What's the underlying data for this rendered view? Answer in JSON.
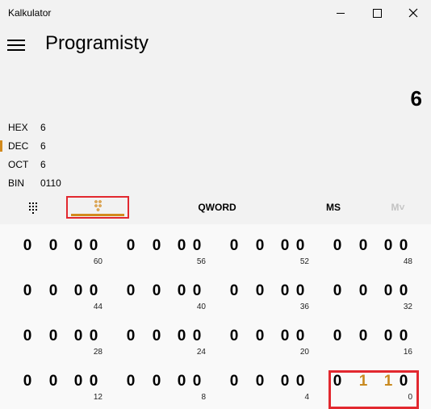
{
  "window": {
    "title": "Kalkulator"
  },
  "header": {
    "mode_title": "Programisty"
  },
  "display": {
    "value": "6",
    "radix": [
      {
        "name": "HEX",
        "value": "6",
        "selected": false
      },
      {
        "name": "DEC",
        "value": "6",
        "selected": true
      },
      {
        "name": "OCT",
        "value": "6",
        "selected": false
      },
      {
        "name": "BIN",
        "value": "0110",
        "selected": false
      }
    ]
  },
  "toolbar": {
    "keypad_icon": "keypad-dots-icon",
    "bitflip_icon": "bit-flip-icon",
    "word_size": "QWORD",
    "memory_store": "MS",
    "memory_view": "M˅"
  },
  "bit_groups": [
    {
      "bits": [
        "0",
        "0",
        "0",
        "0"
      ],
      "index": "60"
    },
    {
      "bits": [
        "0",
        "0",
        "0",
        "0"
      ],
      "index": "56"
    },
    {
      "bits": [
        "0",
        "0",
        "0",
        "0"
      ],
      "index": "52"
    },
    {
      "bits": [
        "0",
        "0",
        "0",
        "0"
      ],
      "index": "48"
    },
    {
      "bits": [
        "0",
        "0",
        "0",
        "0"
      ],
      "index": "44"
    },
    {
      "bits": [
        "0",
        "0",
        "0",
        "0"
      ],
      "index": "40"
    },
    {
      "bits": [
        "0",
        "0",
        "0",
        "0"
      ],
      "index": "36"
    },
    {
      "bits": [
        "0",
        "0",
        "0",
        "0"
      ],
      "index": "32"
    },
    {
      "bits": [
        "0",
        "0",
        "0",
        "0"
      ],
      "index": "28"
    },
    {
      "bits": [
        "0",
        "0",
        "0",
        "0"
      ],
      "index": "24"
    },
    {
      "bits": [
        "0",
        "0",
        "0",
        "0"
      ],
      "index": "20"
    },
    {
      "bits": [
        "0",
        "0",
        "0",
        "0"
      ],
      "index": "16"
    },
    {
      "bits": [
        "0",
        "0",
        "0",
        "0"
      ],
      "index": "12"
    },
    {
      "bits": [
        "0",
        "0",
        "0",
        "0"
      ],
      "index": "8"
    },
    {
      "bits": [
        "0",
        "0",
        "0",
        "0"
      ],
      "index": "4"
    },
    {
      "bits": [
        "0",
        "1",
        "1",
        "0"
      ],
      "index": "0"
    }
  ],
  "colors": {
    "accent": "#d28a1e",
    "highlight": "#e2282f",
    "bit_on": "#c98a20"
  }
}
